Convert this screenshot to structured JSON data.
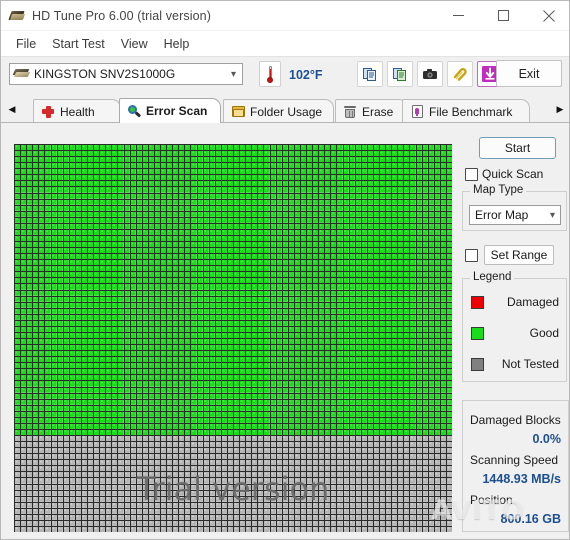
{
  "window": {
    "title": "HD Tune Pro 6.00 (trial version)",
    "icon": "hard-disk-icon",
    "controls": {
      "minimize": "minimize-icon",
      "maximize": "maximize-icon",
      "close": "close-icon"
    }
  },
  "menu": {
    "items": [
      "File",
      "Start Test",
      "View",
      "Help"
    ]
  },
  "toolbar": {
    "drive": {
      "value": "KINGSTON SNV2S1000G",
      "icon": "hard-disk-icon",
      "arrow": "chevron-down-icon"
    },
    "temperature": {
      "icon": "thermometer-icon",
      "value": "102°F",
      "color": "#1d4f91"
    },
    "buttons": [
      {
        "name": "copy-info-icon"
      },
      {
        "name": "copy-info-green-icon"
      },
      {
        "name": "screenshot-camera-icon"
      },
      {
        "name": "attachment-icon"
      },
      {
        "name": "save-download-icon"
      }
    ],
    "exit_label": "Exit"
  },
  "tabs": {
    "scroll_left": "scroll-left-arrow",
    "scroll_right": "scroll-right-arrow",
    "items": [
      {
        "label": "Health",
        "icon": "health-cross-icon",
        "active": false
      },
      {
        "label": "Error Scan",
        "icon": "magnifier-icon",
        "active": true
      },
      {
        "label": "Folder Usage",
        "icon": "folder-icon",
        "active": false
      },
      {
        "label": "Erase",
        "icon": "trash-icon",
        "active": false
      },
      {
        "label": "File Benchmark",
        "icon": "file-benchmark-icon",
        "active": false
      }
    ]
  },
  "panel": {
    "start_label": "Start",
    "quick_scan": {
      "label": "Quick Scan",
      "checked": false
    },
    "map_type": {
      "title": "Map Type",
      "value": "Error Map",
      "arrow": "chevron-down-icon"
    },
    "set_range": {
      "label": "Set Range",
      "checked": false
    },
    "legend": {
      "title": "Legend",
      "items": [
        {
          "label": "Damaged",
          "color": "#ee0000"
        },
        {
          "label": "Good",
          "color": "#19dd19"
        },
        {
          "label": "Not Tested",
          "color": "#808080"
        }
      ]
    },
    "stats": [
      {
        "label": "Damaged Blocks",
        "value": "0.0%"
      },
      {
        "label": "Scanning Speed",
        "value": "1448.93 MB/s"
      },
      {
        "label": "Position",
        "value": "800.16 GB"
      }
    ]
  },
  "map": {
    "watermark": "Trial version",
    "overlay_watermark": "AVITO",
    "colors": {
      "good": "#19dd19",
      "not_tested": "#b4b4b4",
      "grid": "#2a2a2a",
      "damaged": "#ee0000"
    },
    "cols": 72,
    "rows": 64,
    "tested_rows": 48
  }
}
